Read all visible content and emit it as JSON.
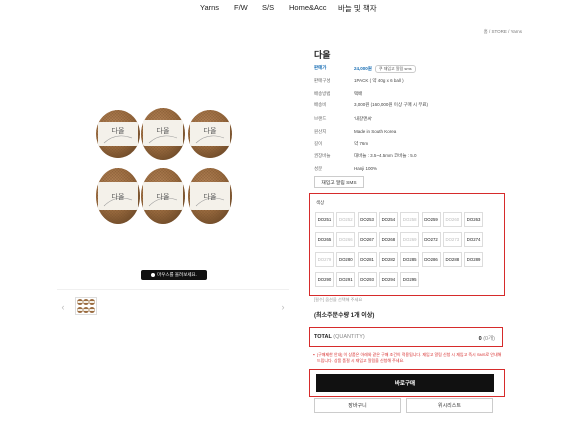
{
  "nav": {
    "items": [
      "Yarns",
      "F/W",
      "S/S",
      "Home&Acc",
      "바늘 및 책자"
    ]
  },
  "breadcrumb": "홈 / STORE / Yarns",
  "product": {
    "title": "다올",
    "info": [
      {
        "label": "판매가",
        "value": "24,000원",
        "coupon": "쿠 재입고 알림 sms"
      },
      {
        "label": "판매구성",
        "value": "1PACK ( 약 40g x 6 ball )"
      },
      {
        "label": "배송방법",
        "value": "택배"
      },
      {
        "label": "배송비",
        "value": "3,000원 (160,000원 이상 구매 시 무료)"
      },
      {
        "label": "브랜드",
        "value": "'내갈앤씨'"
      },
      {
        "label": "원산지",
        "value": "Made in South Korea"
      },
      {
        "label": "길이",
        "value": "약 76m"
      },
      {
        "label": "권장바늘",
        "value": "대바늘 : 3.5~4.5mm 코바늘 : 5.0"
      },
      {
        "label": "성분",
        "value": "Hanji 100%"
      }
    ],
    "sms_button": "재입고 알림 SMS"
  },
  "gallery": {
    "zoom_hint": "마우스를 올려보세요.",
    "prev_icon": "‹",
    "next_icon": "›"
  },
  "color_option": {
    "label": "색상",
    "swatches": [
      {
        "code": "DO251",
        "soldout": false
      },
      {
        "code": "DO252",
        "soldout": true
      },
      {
        "code": "DO253",
        "soldout": false
      },
      {
        "code": "DO254",
        "soldout": false
      },
      {
        "code": "DO258",
        "soldout": true
      },
      {
        "code": "DO259",
        "soldout": false
      },
      {
        "code": "DO260",
        "soldout": true
      },
      {
        "code": "DO263",
        "soldout": false
      },
      {
        "code": "DO265",
        "soldout": false
      },
      {
        "code": "DO266",
        "soldout": true
      },
      {
        "code": "DO267",
        "soldout": false
      },
      {
        "code": "DO268",
        "soldout": false
      },
      {
        "code": "DO269",
        "soldout": true
      },
      {
        "code": "DO272",
        "soldout": false
      },
      {
        "code": "DO273",
        "soldout": true
      },
      {
        "code": "DO274",
        "soldout": false
      },
      {
        "code": "DO279",
        "soldout": true
      },
      {
        "code": "DO280",
        "soldout": false
      },
      {
        "code": "DO281",
        "soldout": false
      },
      {
        "code": "DO282",
        "soldout": false
      },
      {
        "code": "DO285",
        "soldout": false
      },
      {
        "code": "DO286",
        "soldout": false
      },
      {
        "code": "DO288",
        "soldout": false
      },
      {
        "code": "DO289",
        "soldout": false
      },
      {
        "code": "DO290",
        "soldout": false
      },
      {
        "code": "DO291",
        "soldout": false
      },
      {
        "code": "DO293",
        "soldout": false
      },
      {
        "code": "DO294",
        "soldout": false
      },
      {
        "code": "DO295",
        "soldout": false
      }
    ]
  },
  "option_note": "[필수] 옵션을 선택해 주세요",
  "min_order": "(최소주문수량 1개 이상)",
  "total": {
    "label": "TOTAL",
    "qty_label": "(QUANTITY)",
    "value": "0",
    "count": "(0개)"
  },
  "notice": "[구매제한 안내] 이 상품은 아래와 같은 구매 조건이 적용됩니다. 재입고 알림 신청 시 재입고 즉시 SMS로 안내해 드립니다. 상품 품절 시 재입고 알림을 신청해 주세요.",
  "buttons": {
    "buy": "바로구매",
    "cart": "장바구니",
    "wishlist": "위시리스트"
  },
  "colors": {
    "accent_red": "#d62b2b",
    "price_blue": "#1a6fb5",
    "yarn_brown": "#9a6b3f",
    "button_black": "#111111"
  }
}
